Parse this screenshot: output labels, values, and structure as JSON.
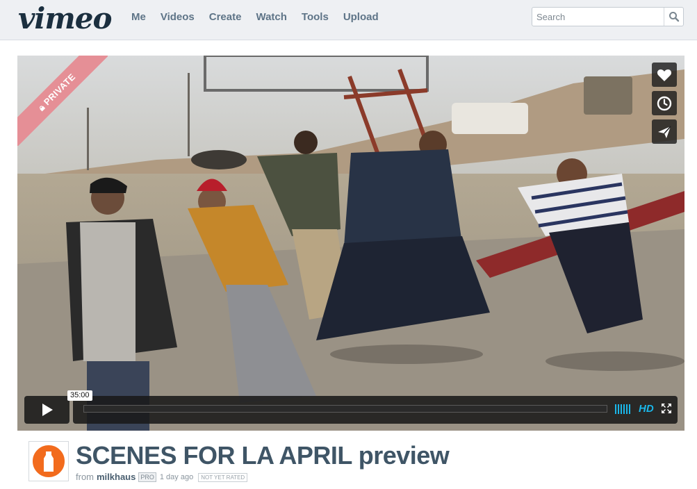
{
  "header": {
    "logo": "vimeo",
    "nav": [
      "Me",
      "Videos",
      "Create",
      "Watch",
      "Tools",
      "Upload"
    ],
    "search_placeholder": "Search"
  },
  "player": {
    "badge": "PRIVATE",
    "timecode": "35:00",
    "hd_label": "HD",
    "progress": 0,
    "side_buttons": [
      "heart-icon",
      "clock-icon",
      "paper-plane-icon"
    ]
  },
  "video": {
    "title": "SCENES FOR LA APRIL preview",
    "from_label": "from",
    "user": "milkhaus",
    "pro_badge": "PRO",
    "uploaded": "1 day ago",
    "rating": "NOT YET RATED"
  },
  "colors": {
    "accent": "#1ab7ea",
    "title": "#3f5566",
    "private_ribbon": "#e58f96",
    "avatar_orange": "#f26b1d"
  }
}
